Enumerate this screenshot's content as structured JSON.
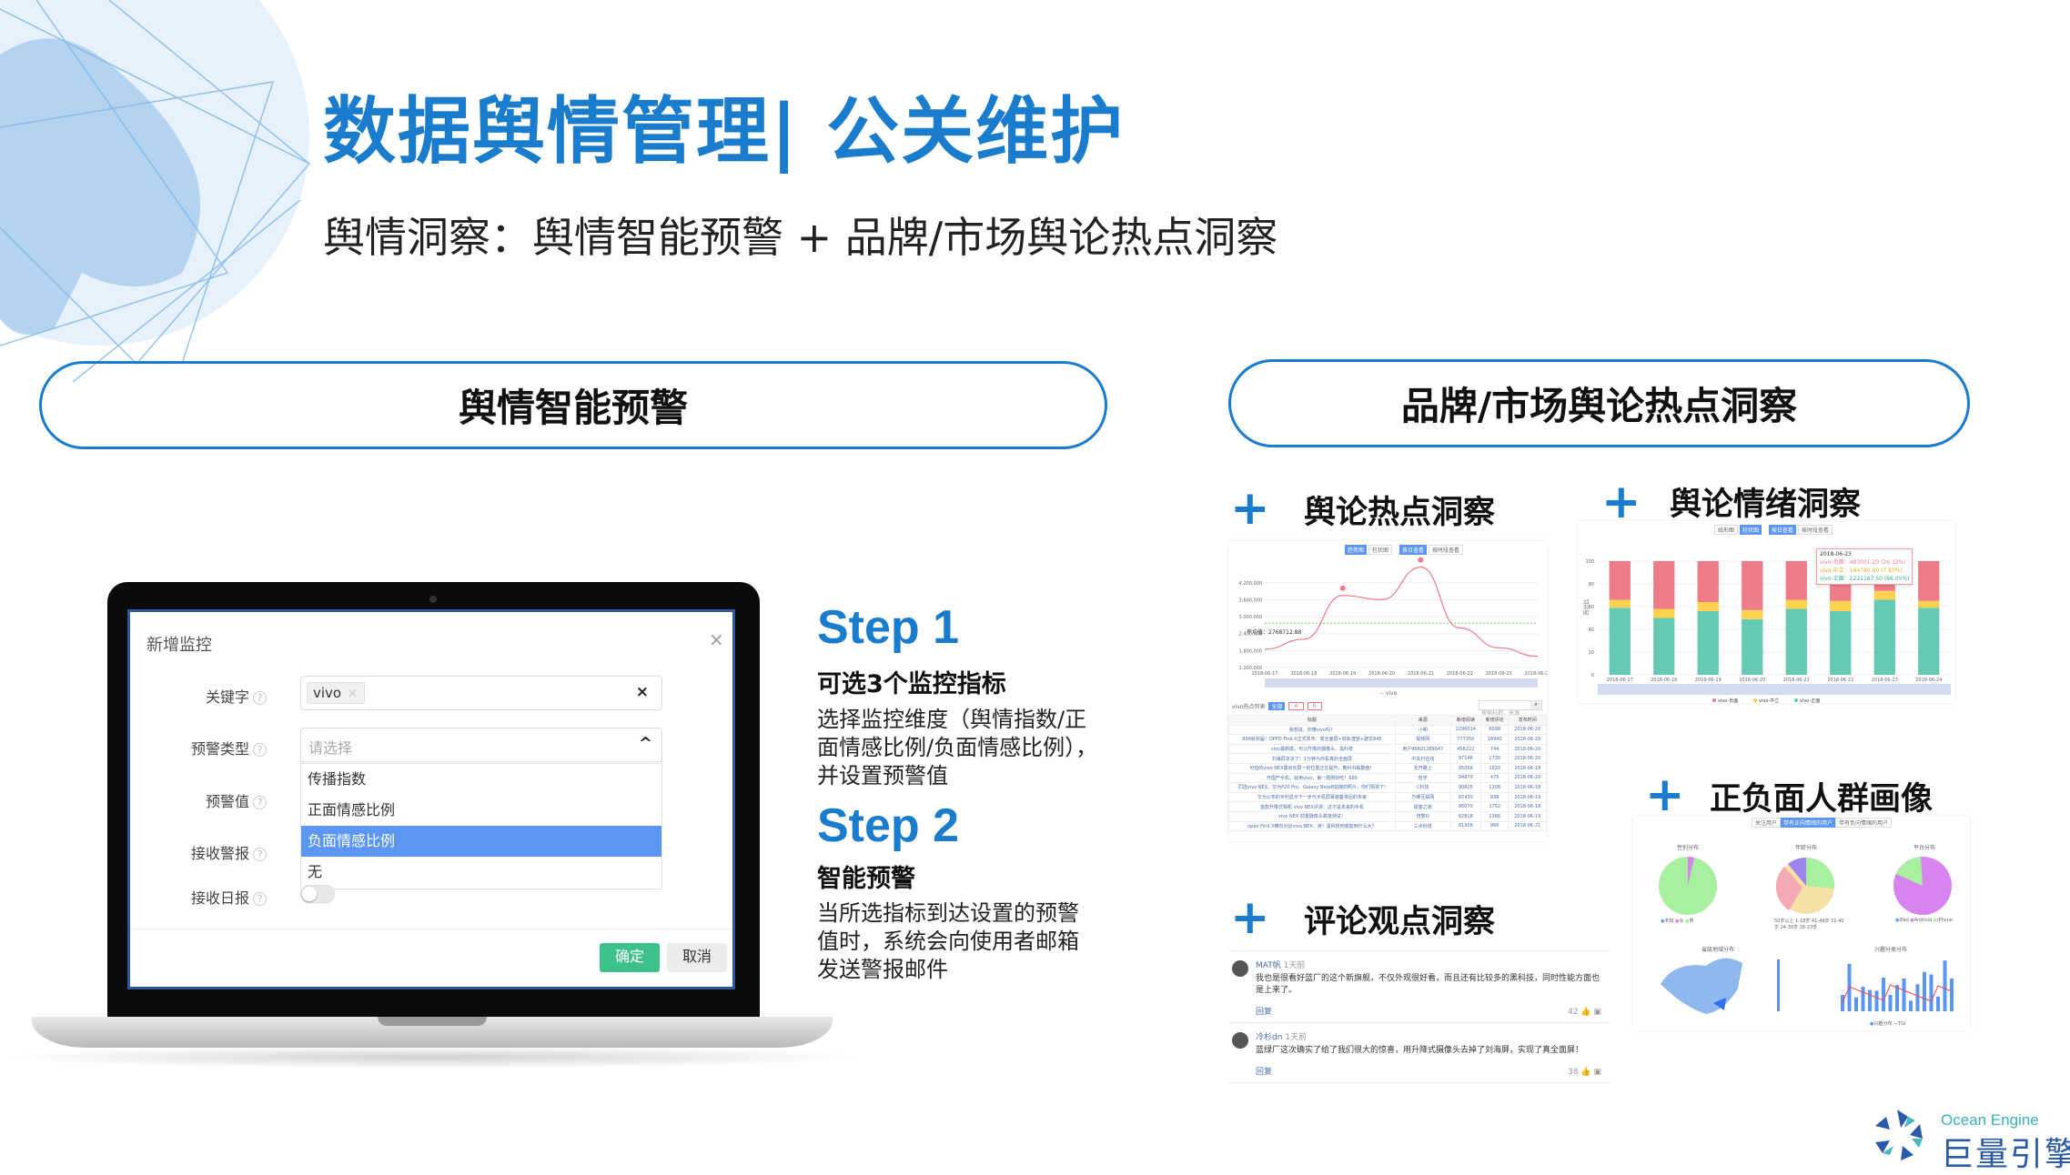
{
  "header": {
    "title": "数据舆情管理| 公关维护",
    "subtitle": "舆情洞察：舆情智能预警 + 品牌/市场舆论热点洞察"
  },
  "left_section": {
    "pill": "舆情智能预警"
  },
  "right_section": {
    "pill": "品牌/市场舆论热点洞察"
  },
  "dialog": {
    "title": "新增监控",
    "close": "×",
    "fields": [
      {
        "label": "关键字",
        "tag": "vivo",
        "tag_remove": "×",
        "clear": "×"
      },
      {
        "label": "预警类型",
        "placeholder": "请选择",
        "chevron": "^"
      },
      {
        "label": "预警值"
      },
      {
        "label": "接收警报"
      },
      {
        "label": "接收日报"
      }
    ],
    "help": "?",
    "options": [
      "传播指数",
      "正面情感比例",
      "负面情感比例",
      "无"
    ],
    "highlighted_option": "负面情感比例",
    "daily_report_toggle": false,
    "confirm": "确定",
    "cancel": "取消",
    "colors": {
      "confirm": "#3ec08b",
      "highlight": "#5a96f2"
    }
  },
  "steps": [
    {
      "label": "Step 1",
      "heading": "可选3个监控指标",
      "desc": "选择监控维度（舆情指数/正面情感比例/负面情感比例），并设置预警值"
    },
    {
      "label": "Step 2",
      "heading": "智能预警",
      "desc": "当所选指标到达设置的预警值时，系统会向使用者邮箱发送警报邮件"
    }
  ],
  "sections": {
    "hot": {
      "plus": "+",
      "title": "舆论热点洞察"
    },
    "emotion": {
      "plus": "+",
      "title": "舆论情绪洞察"
    },
    "crowd": {
      "plus": "+",
      "title": "正负面人群画像"
    },
    "comments": {
      "plus": "+",
      "title": "评论观点洞察"
    }
  },
  "hot_panel": {
    "toggles": [
      "趋势图",
      "柱状图",
      "按日查看",
      "按时段查看"
    ],
    "legend": "vivo",
    "avg_label": "平均值：2768712.88",
    "list_title": "vivo热点列表",
    "filters": [
      "全部",
      "A",
      "B"
    ],
    "search_placeholder": "搜索标题、来源",
    "table_headers": [
      "标题",
      "来源",
      "新增阅读",
      "新增评论",
      "发布时间"
    ],
    "rows": [
      [
        "我想说，你懂vivo吗？",
        "小明",
        "2296014",
        "6098",
        "2018-06-20"
      ],
      [
        "999就完届！OPPO Find X正式发布：真全面屏+双轨潜望+骁龙845",
        "视频网",
        "777356",
        "18940",
        "2018-06-20"
      ],
      [
        "vivo最新款，可以升降的摄像头，黑科技",
        "用户95601389647",
        "456222",
        "744",
        "2018-06-20"
      ],
      [
        "刘海屏凉凉了！1分钟为你看真的全面屏",
        "中关村在线",
        "97146",
        "1730",
        "2018-06-20"
      ],
      [
        "可怕的vivo NEX露出长屏一的位置正在提升，教科书般翻盘！",
        "花开路上",
        "95056",
        "1020",
        "2018-06-18"
      ],
      [
        "开国产手机，就用vivo，第一把刚好吃！666",
        "哲学",
        "94870",
        "475",
        "2018-06-20"
      ],
      [
        "同选vivo NEX、华为P20 Pro、Galaxy Note8拍摄的照片，你们猜猜下!",
        "C科技",
        "90825",
        "1208",
        "2018-06-18"
      ],
      [
        "华为公布的专利显示下一步代手机屏幕装备将后的未来",
        "万维互联网",
        "87430",
        "898",
        "2018-06-19"
      ],
      [
        "首款升降式相机 vivo NEX评测：这才是未来的手机",
        "极客之家",
        "86070",
        "1752",
        "2018-06-18"
      ],
      [
        "vivo NEX 前置摄像头跌落测试！",
        "倍数Q",
        "82818",
        "1366",
        "2018-06-19"
      ],
      [
        "oppo Find X横向对比vivo NEX，诶！黑科技到底能到什么大？",
        "三点科技",
        "81306",
        "866",
        "2018-06-21"
      ]
    ]
  },
  "emotion_panel": {
    "toggles": [
      "线形图",
      "柱状图",
      "按日查看",
      "按时段查看"
    ],
    "ylabel": "百分比",
    "tooltip": {
      "date": "2018-06-23",
      "lines": [
        "vivo-负面：483001.20 (26.12%)",
        "vivo-中立：144780.00 (7.83%)",
        "vivo-正面：1221187.50 (66.05%)"
      ]
    }
  },
  "crowd_panel": {
    "tabs": [
      "关注用户",
      "带有正向情绪的用户",
      "带有负向情绪的用户"
    ],
    "active_tab": "带有正向情绪的用户",
    "charts": [
      "性别分布",
      "年龄分布",
      "平台分布",
      "省级地域分布",
      "兴趣分类分布"
    ],
    "gender_legend": [
      "未知",
      "女",
      "男"
    ],
    "age_legend": [
      "50岁以上",
      "1-18岁",
      "41-49岁",
      "31-40岁",
      "24-30岁",
      "18-23岁"
    ],
    "platform_legend": [
      "iPad",
      "Android",
      "iPhone"
    ],
    "interest_legend": [
      "兴趣分布",
      "TGI"
    ]
  },
  "comments": [
    {
      "user": "MAT帆",
      "time": "1天前",
      "text": "我也是很看好蓝厂的这个新旗舰，不仅外观很好看，而且还有比较多的黑科技，同时性能方面也是上来了。",
      "reply": "回复",
      "likes": "42"
    },
    {
      "user": "冷杉dn",
      "time": "1天前",
      "text": "蓝绿厂这次确实了给了我们很大的惊喜，用升降式摄像头去掉了刘海屏，实现了真全面屏！",
      "reply": "回复",
      "likes": "38"
    }
  ],
  "logo": {
    "en": "Ocean Engine",
    "cn": "巨量引擎"
  },
  "chart_data": [
    {
      "type": "line",
      "x": [
        "2018-06-17",
        "2018-06-18",
        "2018-06-19",
        "2018-06-20",
        "2018-06-21",
        "2018-06-22",
        "2018-06-23",
        "2018-06-24"
      ],
      "series": [
        {
          "name": "vivo",
          "values": [
            1850000,
            2200000,
            3750000,
            3600000,
            4750000,
            2600000,
            1900000,
            1600000
          ]
        }
      ],
      "y_ticks": [
        "1,200,000",
        "1,800,000",
        "2,400,000",
        "3,000,000",
        "3,600,000",
        "4,200,000"
      ],
      "ylim": [
        1200000,
        4900000
      ],
      "average": 2768712.88,
      "color": "#f07a8a"
    },
    {
      "type": "bar",
      "stacked": true,
      "categories": [
        "2018-06-17",
        "2018-06-18",
        "2018-06-19",
        "2018-06-20",
        "2018-06-21",
        "2018-06-22",
        "2018-06-23",
        "2018-06-24"
      ],
      "series": [
        {
          "name": "vivo-正面",
          "values": [
            59,
            50,
            56,
            49,
            58,
            56,
            66.05,
            59
          ],
          "color": "#66c9b4"
        },
        {
          "name": "vivo-中立",
          "values": [
            7,
            8,
            8,
            8,
            8,
            9,
            7.83,
            6
          ],
          "color": "#fcd24f"
        },
        {
          "name": "vivo-负面",
          "values": [
            34,
            42,
            36,
            43,
            34,
            35,
            26.12,
            35
          ],
          "color": "#ee7c88"
        }
      ],
      "y_ticks": [
        "0",
        "20",
        "40",
        "60",
        "80",
        "100"
      ],
      "ylim": [
        0,
        120
      ]
    }
  ]
}
